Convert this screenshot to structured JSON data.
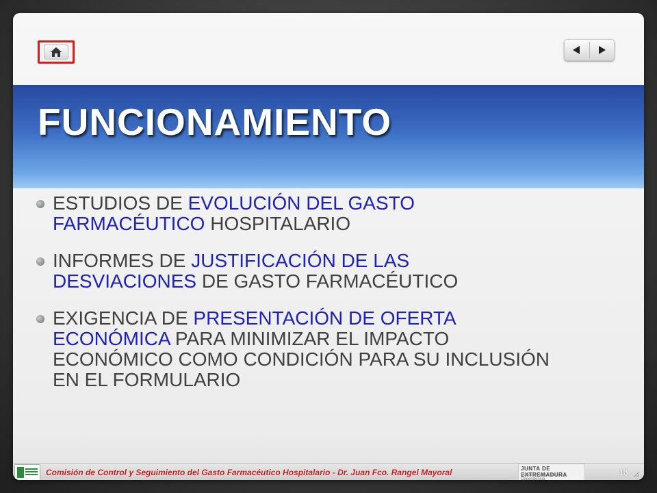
{
  "slide": {
    "title": "FUNCIONAMIENTO",
    "bullets": [
      {
        "parts": [
          "ESTUDIOS DE ",
          "EVOLUCIÓN DEL GASTO FARMACÉUTICO",
          " HOSPITALARIO"
        ]
      },
      {
        "parts": [
          "INFORMES DE ",
          "JUSTIFICACIÓN DE LAS DESVIACIONES",
          " DE GASTO FARMACÉUTICO"
        ]
      },
      {
        "parts": [
          "EXIGENCIA DE ",
          "PRESENTACIÓN DE OFERTA ECONÓMICA",
          " PARA MINIMIZAR EL IMPACTO ECONÓMICO COMO CONDICIÓN PARA SU INCLUSIÓN EN EL FORMULARIO"
        ]
      }
    ],
    "highlight_color": "#1e22b5"
  },
  "nav": {
    "home_icon": "home-icon",
    "prev_icon": "triangle-left-icon",
    "next_icon": "triangle-right-icon"
  },
  "footer": {
    "text": "Comisión de Control y Seguimiento del Gasto Farmacéutico Hospitalario - Dr. Juan Fco. Rangel Mayoral",
    "logo_right_line1": "JUNTA DE EXTREMADURA",
    "logo_right_line2": "Consejería de Sanidad y Dependencia",
    "page_number": "13"
  },
  "colors": {
    "title_band": "#3c6ec4",
    "footer_text": "#c31d1d",
    "home_highlight": "#e01b1b"
  }
}
